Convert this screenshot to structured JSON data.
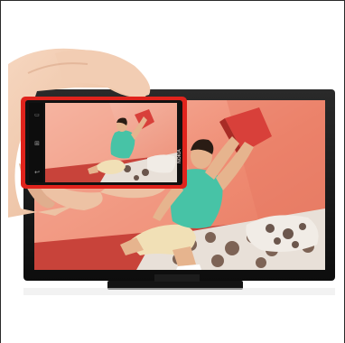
{
  "scene": {
    "phone_brand": "NOKIA",
    "colors": {
      "background": "#ffffff",
      "tv_bezel": "#141414",
      "tv_screen_wall": "#f08a72",
      "tv_screen_wall_light": "#f6b3a0",
      "phone_body": "#e0231c",
      "person_shirt": "#47c3a6",
      "person_shorts": "#f1e0b6",
      "skin": "#e6b48e",
      "hair": "#2a1c14",
      "bed_sheet": "#e8e0d8",
      "bed_frame": "#c8433a",
      "pillow": "#d8403a",
      "hand_skin": "#f0c9ae"
    }
  }
}
